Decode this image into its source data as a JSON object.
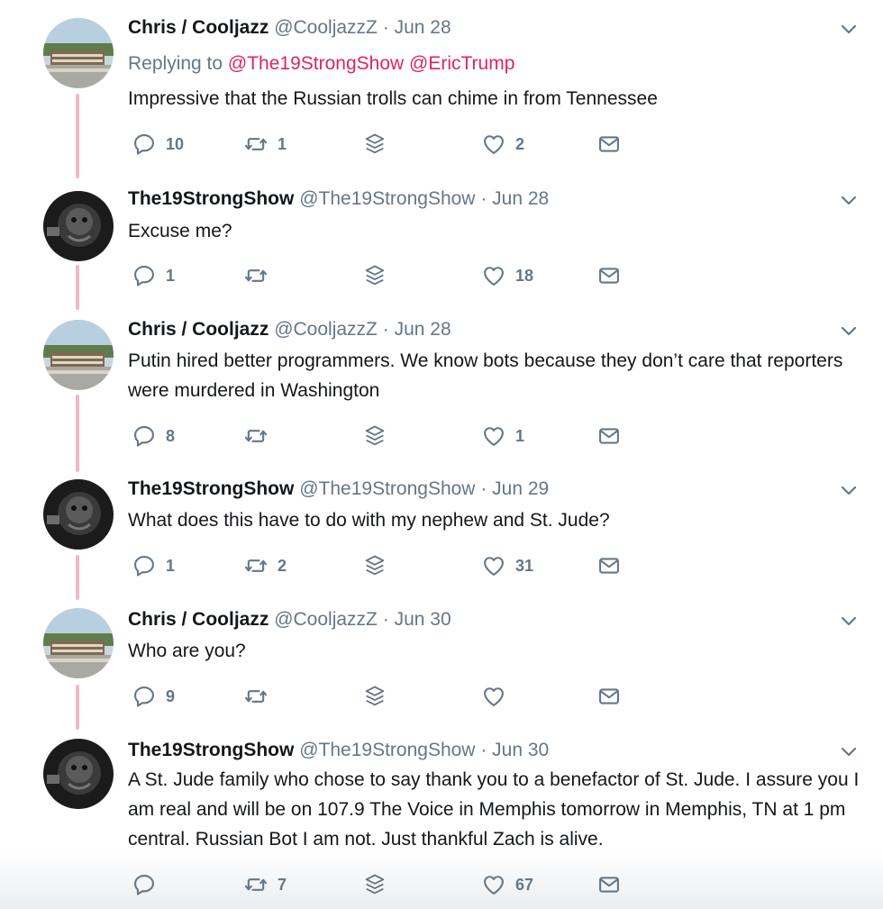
{
  "colors": {
    "mention": "#e0245e",
    "muted": "#657786",
    "thread_line": "#f2b8c6"
  },
  "tweets": [
    {
      "name": "Chris / Cooljazz",
      "handle": "@CooljazzZ",
      "dot": "·",
      "date": "Jun 28",
      "replying_label": "Replying to",
      "replying_to": [
        "@The19StrongShow",
        "@EricTrump"
      ],
      "text": "Impressive that the Russian trolls can chime in from Tennessee",
      "replies": "10",
      "retweets": "1",
      "likes": "2"
    },
    {
      "name": "The19StrongShow",
      "handle": "@The19StrongShow",
      "dot": "·",
      "date": "Jun 28",
      "text": "Excuse me?",
      "replies": "1",
      "retweets": "",
      "likes": "18"
    },
    {
      "name": "Chris / Cooljazz",
      "handle": "@CooljazzZ",
      "dot": "·",
      "date": "Jun 28",
      "text": "Putin  hired better programmers.  We know bots  because they don’t care that reporters were murdered in Washington",
      "replies": "8",
      "retweets": "",
      "likes": "1"
    },
    {
      "name": "The19StrongShow",
      "handle": "@The19StrongShow",
      "dot": "·",
      "date": "Jun 29",
      "text": "What does this have to do with my nephew and St. Jude?",
      "replies": "1",
      "retweets": "2",
      "likes": "31"
    },
    {
      "name": "Chris / Cooljazz",
      "handle": "@CooljazzZ",
      "dot": "·",
      "date": "Jun 30",
      "text": "Who are you?",
      "replies": "9",
      "retweets": "",
      "likes": ""
    },
    {
      "name": "The19StrongShow",
      "handle": "@The19StrongShow",
      "dot": "·",
      "date": "Jun 30",
      "text": "A St. Jude family who chose to say thank you to a benefactor of St. Jude. I assure you I am real and will be on 107.9 The Voice in Memphis tomorrow in Memphis, TN at 1 pm central. Russian Bot I am not. Just thankful Zach is alive.",
      "replies": "",
      "retweets": "7",
      "likes": "67"
    }
  ]
}
